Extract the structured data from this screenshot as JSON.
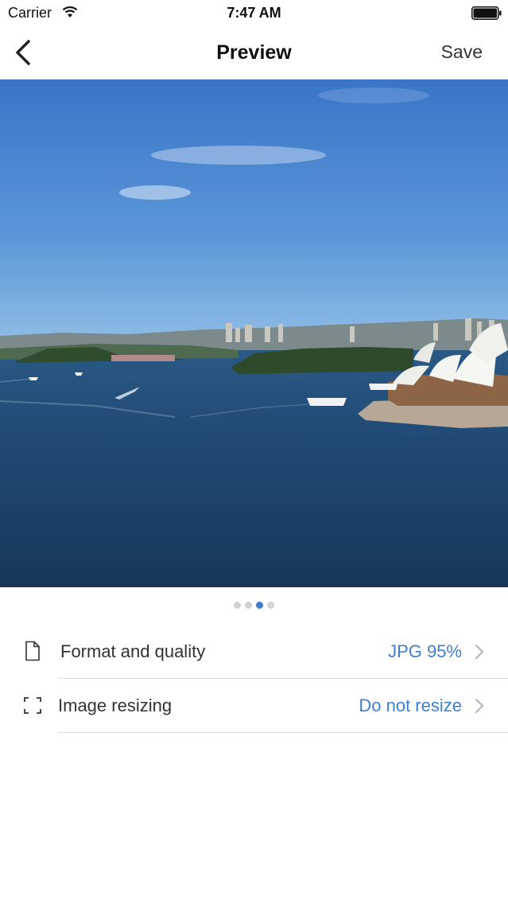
{
  "status_bar": {
    "carrier": "Carrier",
    "time": "7:47 AM"
  },
  "nav": {
    "title": "Preview",
    "save_label": "Save"
  },
  "pager": {
    "count": 4,
    "active_index": 2
  },
  "settings": [
    {
      "label": "Format and quality",
      "value": "JPG 95%",
      "icon": "file-icon"
    },
    {
      "label": "Image resizing",
      "value": "Do not resize",
      "icon": "resize-frame-icon"
    }
  ],
  "colors": {
    "accent": "#3f7fd2",
    "sky_top": "#3a74c8",
    "water": "#1c3f66"
  }
}
